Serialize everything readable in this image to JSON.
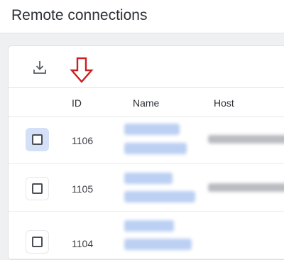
{
  "page": {
    "title": "Remote connections"
  },
  "toolbar": {
    "download_icon": "download-icon"
  },
  "annotation": {
    "icon": "arrow-down-outline-icon",
    "color": "#cc1f1f"
  },
  "table": {
    "columns": [
      "ID",
      "Name",
      "Host"
    ],
    "rows": [
      {
        "id": "1106",
        "selected": false,
        "focused": true
      },
      {
        "id": "1105",
        "selected": false,
        "focused": false
      },
      {
        "id": "1104",
        "selected": false,
        "focused": false
      }
    ]
  },
  "colors": {
    "accent": "#d3e0f7",
    "name_blur": "#bcd0f3",
    "host_blur": "#b9bcc0"
  }
}
